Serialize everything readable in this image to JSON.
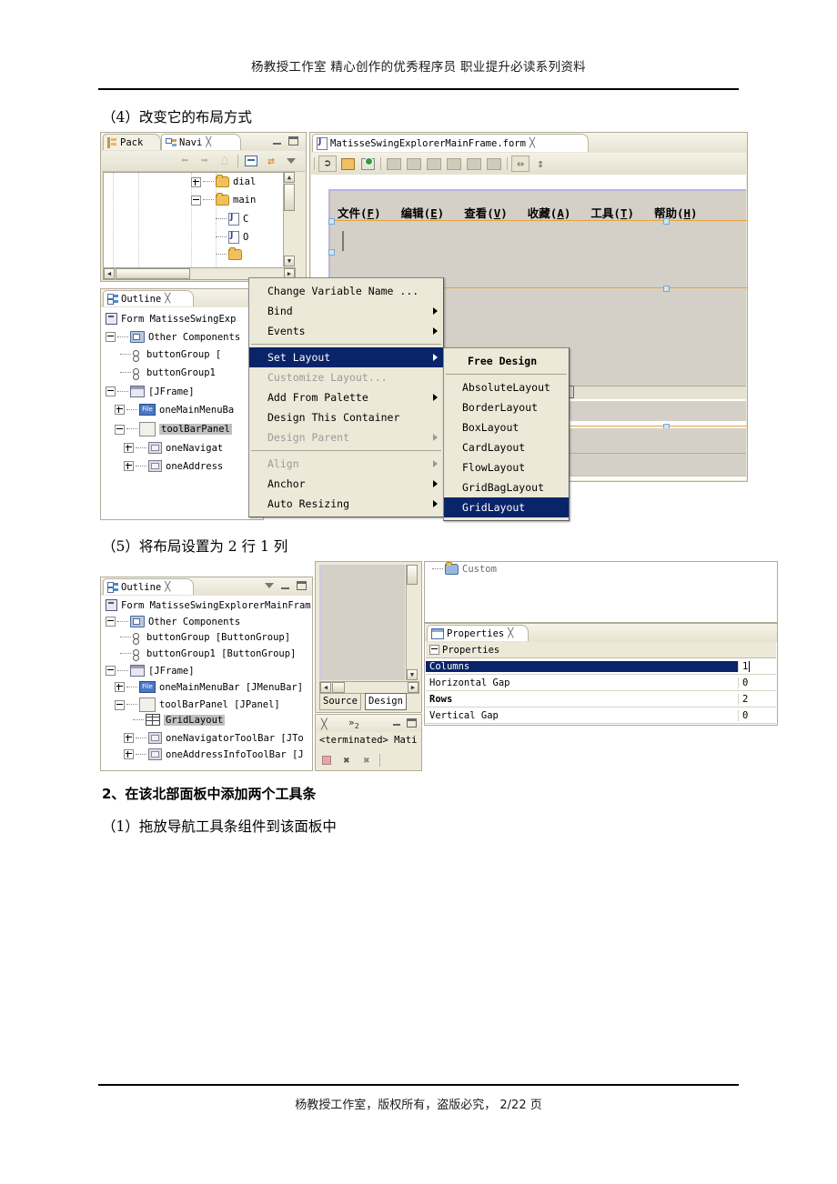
{
  "page": {
    "header_text": "杨教授工作室 精心创作的优秀程序员 职业提升必读系列资料",
    "footer_text": "杨教授工作室，版权所有，盗版必究， 2/22 页"
  },
  "body_text": {
    "step4": "（4）改变它的布局方式",
    "step5": "（5）将布局设置为 2 行 1 列",
    "section2": "2、在该北部面板中添加两个工具条",
    "section2_step1": "（1）拖放导航工具条组件到该面板中"
  },
  "screenshot1": {
    "left_panel": {
      "tabs": [
        {
          "label": "Pack",
          "icon": "package-explorer-icon",
          "selected": false,
          "closeable": false
        },
        {
          "label": "Navi",
          "icon": "navigator-icon",
          "selected": true,
          "closeable": true
        }
      ],
      "window_buttons": [
        "minimize",
        "maximize"
      ],
      "toolbar_icons": [
        "back-arrow-icon",
        "forward-arrow-icon",
        "home-icon",
        "collapse-all-icon",
        "link-editor-icon",
        "view-menu-icon"
      ],
      "tree_items": [
        {
          "label": "dial",
          "icon": "folder-icon",
          "expander": "plus",
          "indent": 0
        },
        {
          "label": "main",
          "icon": "folder-open-icon",
          "expander": "minus",
          "indent": 0
        },
        {
          "label": "C",
          "icon": "java-file-icon",
          "expander": "none",
          "indent": 1
        },
        {
          "label": "O",
          "icon": "java-file-icon",
          "expander": "none",
          "indent": 1
        }
      ]
    },
    "editor_panel": {
      "tab_label": "MatisseSwingExplorerMainFrame.form",
      "tab_icon": "java-form-icon",
      "toolbar_icons": [
        "selection-mode-icon",
        "connection-mode-icon",
        "preview-design-icon",
        "align-left-icon",
        "align-right-icon",
        "align-center-h-icon",
        "align-top-icon",
        "align-bottom-icon",
        "align-center-v-icon",
        "resize-horizontal-icon",
        "resize-vertical-icon"
      ],
      "form_menubar": [
        {
          "text": "文件(",
          "mnemonic": "F",
          "close": ")"
        },
        {
          "text": "编辑(",
          "mnemonic": "E",
          "close": ")"
        },
        {
          "text": "查看(",
          "mnemonic": "V",
          "close": ")"
        },
        {
          "text": "收藏(",
          "mnemonic": "A",
          "close": ")"
        },
        {
          "text": "工具(",
          "mnemonic": "T",
          "close": ")"
        },
        {
          "text": "帮助(",
          "mnemonic": "H",
          "close": ")"
        }
      ]
    },
    "outline_panel": {
      "tab_label": "Outline",
      "tab_icon": "outline-icon",
      "tree_items": [
        {
          "label": "Form MatisseSwingExp",
          "icon": "form-root-icon",
          "expander": "none",
          "indent": 0,
          "state": "normal"
        },
        {
          "label": "Other Components",
          "icon": "other-components-icon",
          "expander": "minus",
          "indent": 0,
          "state": "normal"
        },
        {
          "label": "buttonGroup [",
          "icon": "button-group-icon",
          "expander": "none",
          "indent": 1,
          "state": "normal"
        },
        {
          "label": "buttonGroup1",
          "icon": "button-group-icon",
          "expander": "none",
          "indent": 1,
          "state": "normal"
        },
        {
          "label": "[JFrame]",
          "icon": "jframe-icon",
          "expander": "minus",
          "indent": 0,
          "state": "normal"
        },
        {
          "label": "oneMainMenuBa",
          "icon": "menubar-file-icon",
          "expander": "plus",
          "indent": 1,
          "state": "normal"
        },
        {
          "label": "toolBarPanel",
          "icon": "jpanel-icon",
          "expander": "minus",
          "indent": 1,
          "state": "selected-gray"
        },
        {
          "label": "oneNavigat",
          "icon": "jtoolbar-icon",
          "expander": "plus",
          "indent": 2,
          "state": "normal"
        },
        {
          "label": "oneAddress",
          "icon": "jtoolbar-icon",
          "expander": "plus",
          "indent": 2,
          "state": "normal"
        }
      ]
    },
    "context_menu": {
      "items": [
        {
          "label": "Change Variable Name ...",
          "submenu": false,
          "enabled": true,
          "selected": false
        },
        {
          "label": "Bind",
          "submenu": true,
          "enabled": true,
          "selected": false
        },
        {
          "label": "Events",
          "submenu": true,
          "enabled": true,
          "selected": false
        },
        {
          "separator_after": true,
          "label": "__sep1__"
        },
        {
          "label": "Set Layout",
          "submenu": true,
          "enabled": true,
          "selected": true
        },
        {
          "label": "Customize Layout...",
          "submenu": false,
          "enabled": false,
          "selected": false
        },
        {
          "label": "Add From Palette",
          "submenu": true,
          "enabled": true,
          "selected": false
        },
        {
          "label": "Design This Container",
          "submenu": false,
          "enabled": true,
          "selected": false
        },
        {
          "label": "Design Parent",
          "submenu": true,
          "enabled": false,
          "selected": false
        },
        {
          "separator_after": true,
          "label": "__sep2__"
        },
        {
          "label": "Align",
          "submenu": true,
          "enabled": false,
          "selected": false
        },
        {
          "label": "Anchor",
          "submenu": true,
          "enabled": true,
          "selected": false
        },
        {
          "label": "Auto Resizing",
          "submenu": true,
          "enabled": true,
          "selected": false
        }
      ]
    },
    "layout_submenu": {
      "items": [
        {
          "label": "Free Design",
          "bold": true,
          "selected": false
        },
        {
          "separator_after": true,
          "label": "__sep__"
        },
        {
          "label": "AbsoluteLayout",
          "bold": false,
          "selected": false
        },
        {
          "label": "BorderLayout",
          "bold": false,
          "selected": false
        },
        {
          "label": "BoxLayout",
          "bold": false,
          "selected": false
        },
        {
          "label": "CardLayout",
          "bold": false,
          "selected": false
        },
        {
          "label": "FlowLayout",
          "bold": false,
          "selected": false
        },
        {
          "label": "GridBagLayout",
          "bold": false,
          "selected": false
        },
        {
          "label": "GridLayout",
          "bold": false,
          "selected": true
        }
      ]
    },
    "bottom_toolbar_icons": [
      "terminate-icon",
      "remove-launch-icon",
      "remove-all-launches-icon",
      "new-file-icon",
      "secure-storage-icon",
      "display-selected-console-icon",
      "open-console-icon"
    ]
  },
  "screenshot2": {
    "outline_panel": {
      "tab_label": "Outline",
      "tab_icon": "outline-icon",
      "window_buttons": [
        "view-menu",
        "minimize",
        "maximize"
      ],
      "tree_items": [
        {
          "label": "Form MatisseSwingExplorerMainFrame",
          "icon": "form-root-icon",
          "expander": "none",
          "indent": 0,
          "state": "normal"
        },
        {
          "label": "Other Components",
          "icon": "other-components-icon",
          "expander": "minus",
          "indent": 0,
          "state": "normal"
        },
        {
          "label": "buttonGroup [ButtonGroup]",
          "icon": "button-group-icon",
          "expander": "none",
          "indent": 1,
          "state": "normal"
        },
        {
          "label": "buttonGroup1 [ButtonGroup]",
          "icon": "button-group-icon",
          "expander": "none",
          "indent": 1,
          "state": "normal"
        },
        {
          "label": "[JFrame]",
          "icon": "jframe-icon",
          "expander": "minus",
          "indent": 0,
          "state": "normal"
        },
        {
          "label": "oneMainMenuBar [JMenuBar]",
          "icon": "menubar-file-icon",
          "expander": "plus",
          "indent": 1,
          "state": "normal"
        },
        {
          "label": "toolBarPanel [JPanel]",
          "icon": "jpanel-icon",
          "expander": "minus",
          "indent": 1,
          "state": "normal"
        },
        {
          "label": "GridLayout",
          "icon": "grid-layout-icon",
          "expander": "none",
          "indent": 2,
          "state": "selected-gray"
        },
        {
          "label": "oneNavigatorToolBar [JTo",
          "icon": "jtoolbar-icon",
          "expander": "plus",
          "indent": 2,
          "state": "normal"
        },
        {
          "label": "oneAddressInfoToolBar [J",
          "icon": "jtoolbar-icon",
          "expander": "plus",
          "indent": 2,
          "state": "normal"
        }
      ]
    },
    "editor_tabs": [
      {
        "label": "Source",
        "selected": false
      },
      {
        "label": "Design",
        "selected": true
      }
    ],
    "console_panel": {
      "tab_icon": "console-icon",
      "overflow_label": "»",
      "overflow_count": "2",
      "status_text": "<terminated> Mati",
      "toolbar_icons": [
        "terminate-icon",
        "remove-launch-icon",
        "remove-all-launches-icon"
      ]
    },
    "palette_item": {
      "label": "Custom",
      "icon": "folder-icon"
    },
    "properties_panel": {
      "tab_label": "Properties",
      "tab_icon": "properties-icon",
      "group_label": "Properties",
      "rows": [
        {
          "name": "Columns",
          "value": "1",
          "highlighted": true,
          "bold": false,
          "editing": true
        },
        {
          "name": "Horizontal Gap",
          "value": "0",
          "highlighted": false,
          "bold": false,
          "editing": false
        },
        {
          "name": "Rows",
          "value": "2",
          "highlighted": false,
          "bold": true,
          "editing": false
        },
        {
          "name": "Vertical Gap",
          "value": "0",
          "highlighted": false,
          "bold": false,
          "editing": false
        }
      ]
    }
  },
  "colors": {
    "menu_highlight": "#0a246a",
    "panel_bg": "#ece9d8",
    "form_bg": "#d4d0c8",
    "orange_guide": "#e8a13a",
    "tree_select_gray": "#c0c0c0"
  }
}
